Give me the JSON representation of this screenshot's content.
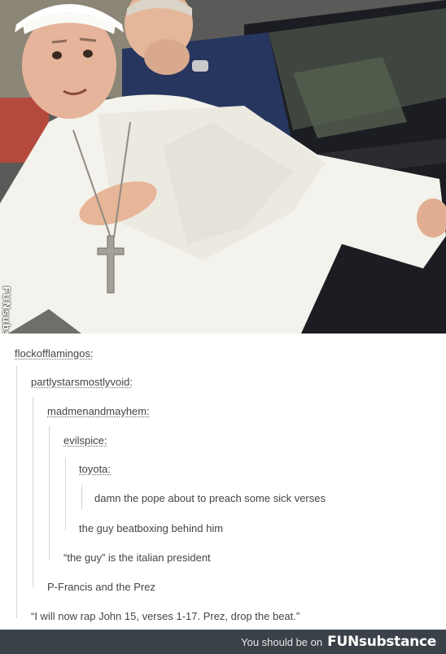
{
  "watermark_side": "FUNsubstance",
  "thread": {
    "users": [
      "flockofflamingos:",
      "partlystarsmostlyvoid:",
      "madmenandmayhem:",
      "evilspice:",
      "toyota:"
    ],
    "quote": "damn the pope about to preach some sick verses",
    "replies": [
      "the guy beatboxing behind him",
      "“the guy” is the italian president",
      "P-Francis and the Prez",
      "“I will now rap John 15, verses 1-17. Prez, drop the beat.”"
    ]
  },
  "footer": {
    "text": "You should be on",
    "logo": "FUNsubstance",
    "background": "#3b4148"
  },
  "colors": {
    "robe": "#f3f2ec",
    "suit": "#27365e",
    "car": "#1b1d22"
  }
}
